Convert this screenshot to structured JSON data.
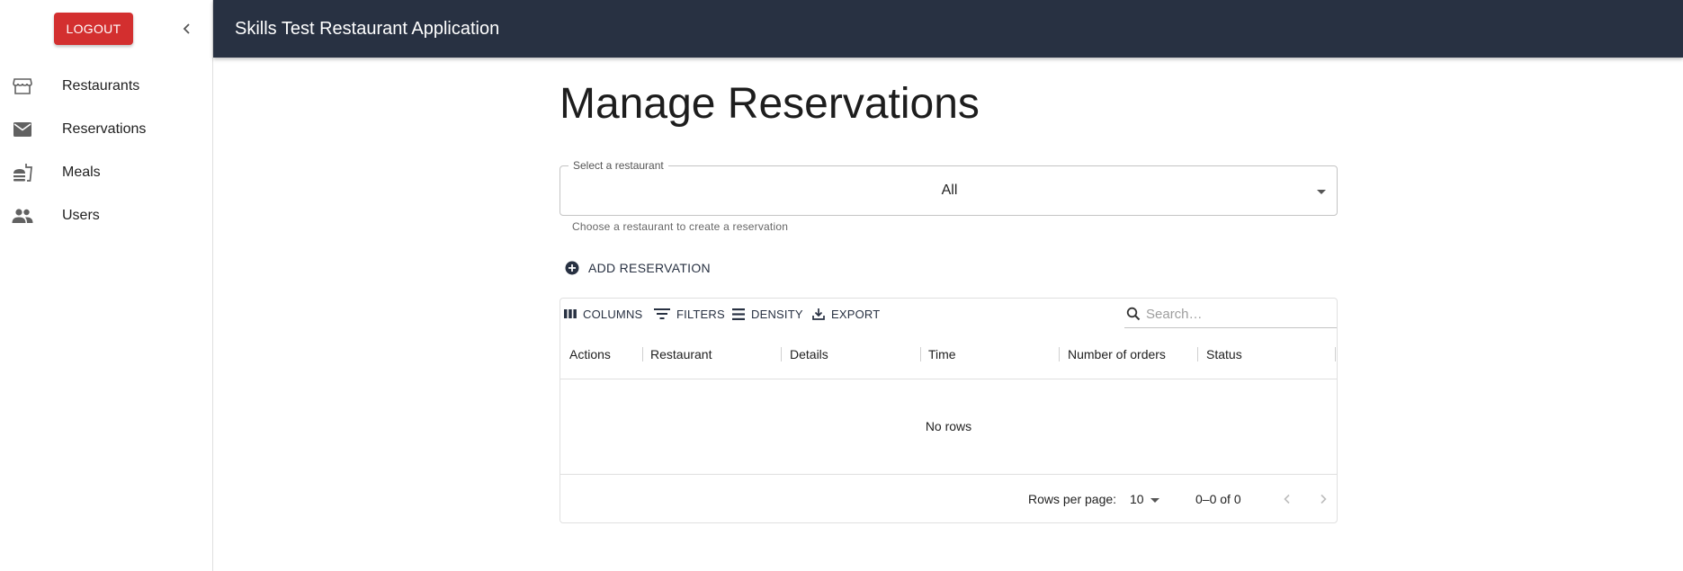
{
  "sidebar": {
    "logout_label": "LOGOUT",
    "items": [
      {
        "label": "Restaurants",
        "icon": "storefront-icon"
      },
      {
        "label": "Reservations",
        "icon": "mail-icon"
      },
      {
        "label": "Meals",
        "icon": "fastfood-icon"
      },
      {
        "label": "Users",
        "icon": "people-icon"
      }
    ]
  },
  "appbar": {
    "title": "Skills Test Restaurant Application"
  },
  "main": {
    "title": "Manage Reservations",
    "select": {
      "label": "Select a restaurant",
      "value": "All",
      "helper": "Choose a restaurant to create a reservation"
    },
    "add_button": "ADD RESERVATION"
  },
  "grid": {
    "toolbar": {
      "columns": "COLUMNS",
      "filters": "FILTERS",
      "density": "DENSITY",
      "export": "EXPORT",
      "search_placeholder": "Search…"
    },
    "columns": [
      "Actions",
      "Restaurant",
      "Details",
      "Time",
      "Number of orders",
      "Status"
    ],
    "empty_text": "No rows",
    "footer": {
      "rows_per_page_label": "Rows per page:",
      "rows_per_page": "10",
      "range": "0–0 of 0"
    }
  },
  "colors": {
    "appbar": "#283142",
    "logout": "#d32f2f",
    "accent": "#283142"
  }
}
